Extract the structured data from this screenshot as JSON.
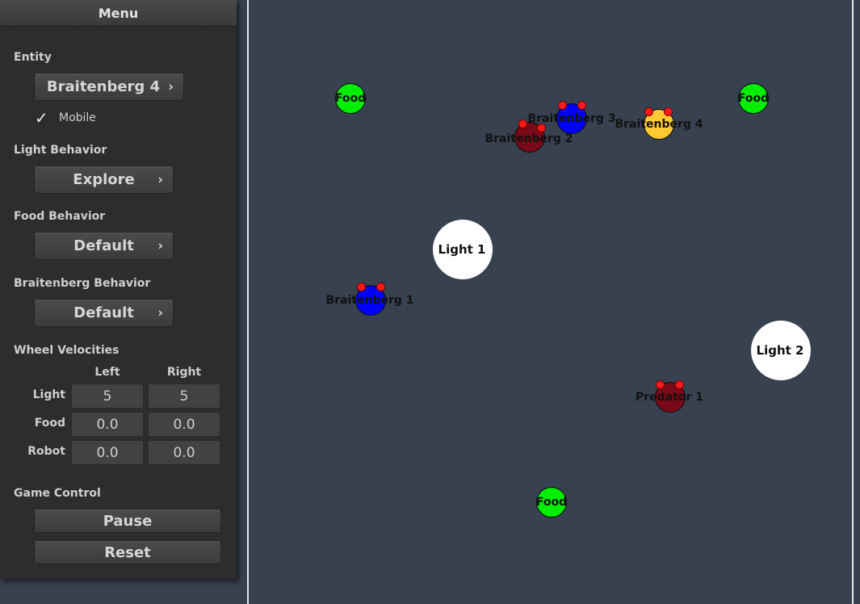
{
  "menu": {
    "title": "Menu",
    "entity_label": "Entity",
    "entity_value": "Braitenberg 4",
    "mobile_label": "Mobile",
    "light_behavior_label": "Light Behavior",
    "light_behavior_value": "Explore",
    "food_behavior_label": "Food Behavior",
    "food_behavior_value": "Default",
    "braitenberg_behavior_label": "Braitenberg Behavior",
    "braitenberg_behavior_value": "Default",
    "chevron": "›",
    "check_glyph": "✓",
    "wheel_velocities_label": "Wheel Velocities",
    "vel_left_header": "Left",
    "vel_right_header": "Right",
    "rows": {
      "light": {
        "label": "Light",
        "left": "5",
        "right": "5"
      },
      "food": {
        "label": "Food",
        "left": "0.0",
        "right": "0.0"
      },
      "robot": {
        "label": "Robot",
        "left": "0.0",
        "right": "0.0"
      }
    },
    "game_control_label": "Game Control",
    "pause_label": "Pause",
    "reset_label": "Reset"
  },
  "arena": {
    "foods": [
      "Food",
      "Food",
      "Food"
    ],
    "lights": [
      "Light 1",
      "Light 2"
    ],
    "robots": [
      "Braitenberg 1",
      "Braitenberg 2",
      "Braitenberg 3",
      "Braitenberg 4"
    ],
    "predator": "Predator 1",
    "colors": {
      "food": "#00ee00",
      "light": "#ffffff",
      "blue_robot": "#0000ff",
      "dark_red_robot": "#7a0a18",
      "yellow_robot": "#ffc934",
      "sensor": "#ff1a1a",
      "background": "#374150"
    }
  }
}
